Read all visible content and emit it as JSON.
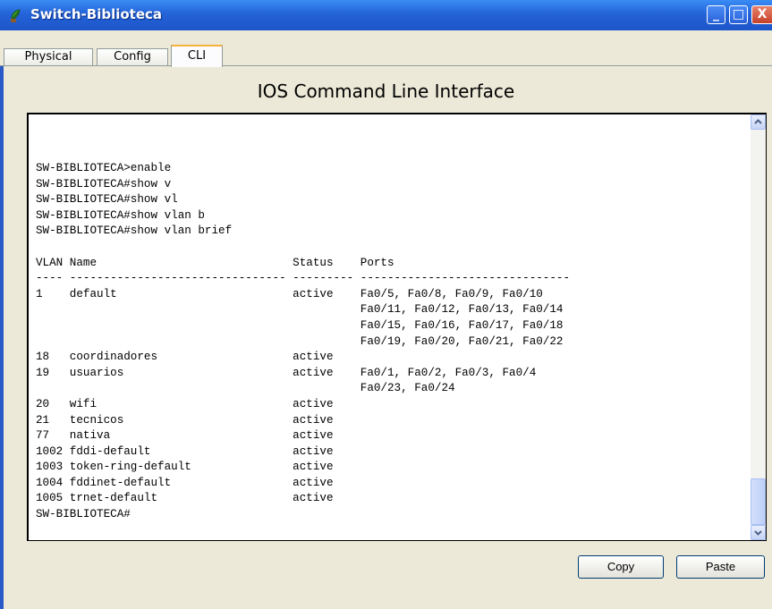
{
  "window": {
    "title": "Switch-Biblioteca",
    "title_icon": "switch-plant-icon",
    "controls": {
      "minimize": "_",
      "maximize": "□",
      "close": "X"
    }
  },
  "tabs": [
    {
      "label": "Physical",
      "active": false
    },
    {
      "label": "Config",
      "active": false
    },
    {
      "label": "CLI",
      "active": true
    }
  ],
  "cli": {
    "heading": "IOS Command Line Interface",
    "output": "SW-BIBLIOTECA>enable\nSW-BIBLIOTECA#show v\nSW-BIBLIOTECA#show vl\nSW-BIBLIOTECA#show vlan b\nSW-BIBLIOTECA#show vlan brief\n\nVLAN Name                             Status    Ports\n---- -------------------------------- --------- -------------------------------\n1    default                          active    Fa0/5, Fa0/8, Fa0/9, Fa0/10\n                                                Fa0/11, Fa0/12, Fa0/13, Fa0/14\n                                                Fa0/15, Fa0/16, Fa0/17, Fa0/18\n                                                Fa0/19, Fa0/20, Fa0/21, Fa0/22\n18   coordinadores                    active\n19   usuarios                         active    Fa0/1, Fa0/2, Fa0/3, Fa0/4\n                                                Fa0/23, Fa0/24\n20   wifi                             active\n21   tecnicos                         active\n77   nativa                           active\n1002 fddi-default                     active\n1003 token-ring-default               active\n1004 fddinet-default                  active\n1005 trnet-default                    active\nSW-BIBLIOTECA#"
  },
  "buttons": {
    "copy": "Copy",
    "paste": "Paste"
  },
  "colors": {
    "titlebar": "#2463d8",
    "active_tab_accent": "#f3b33c",
    "window_bg": "#ece9d8",
    "terminal_bg": "#ffffff"
  }
}
